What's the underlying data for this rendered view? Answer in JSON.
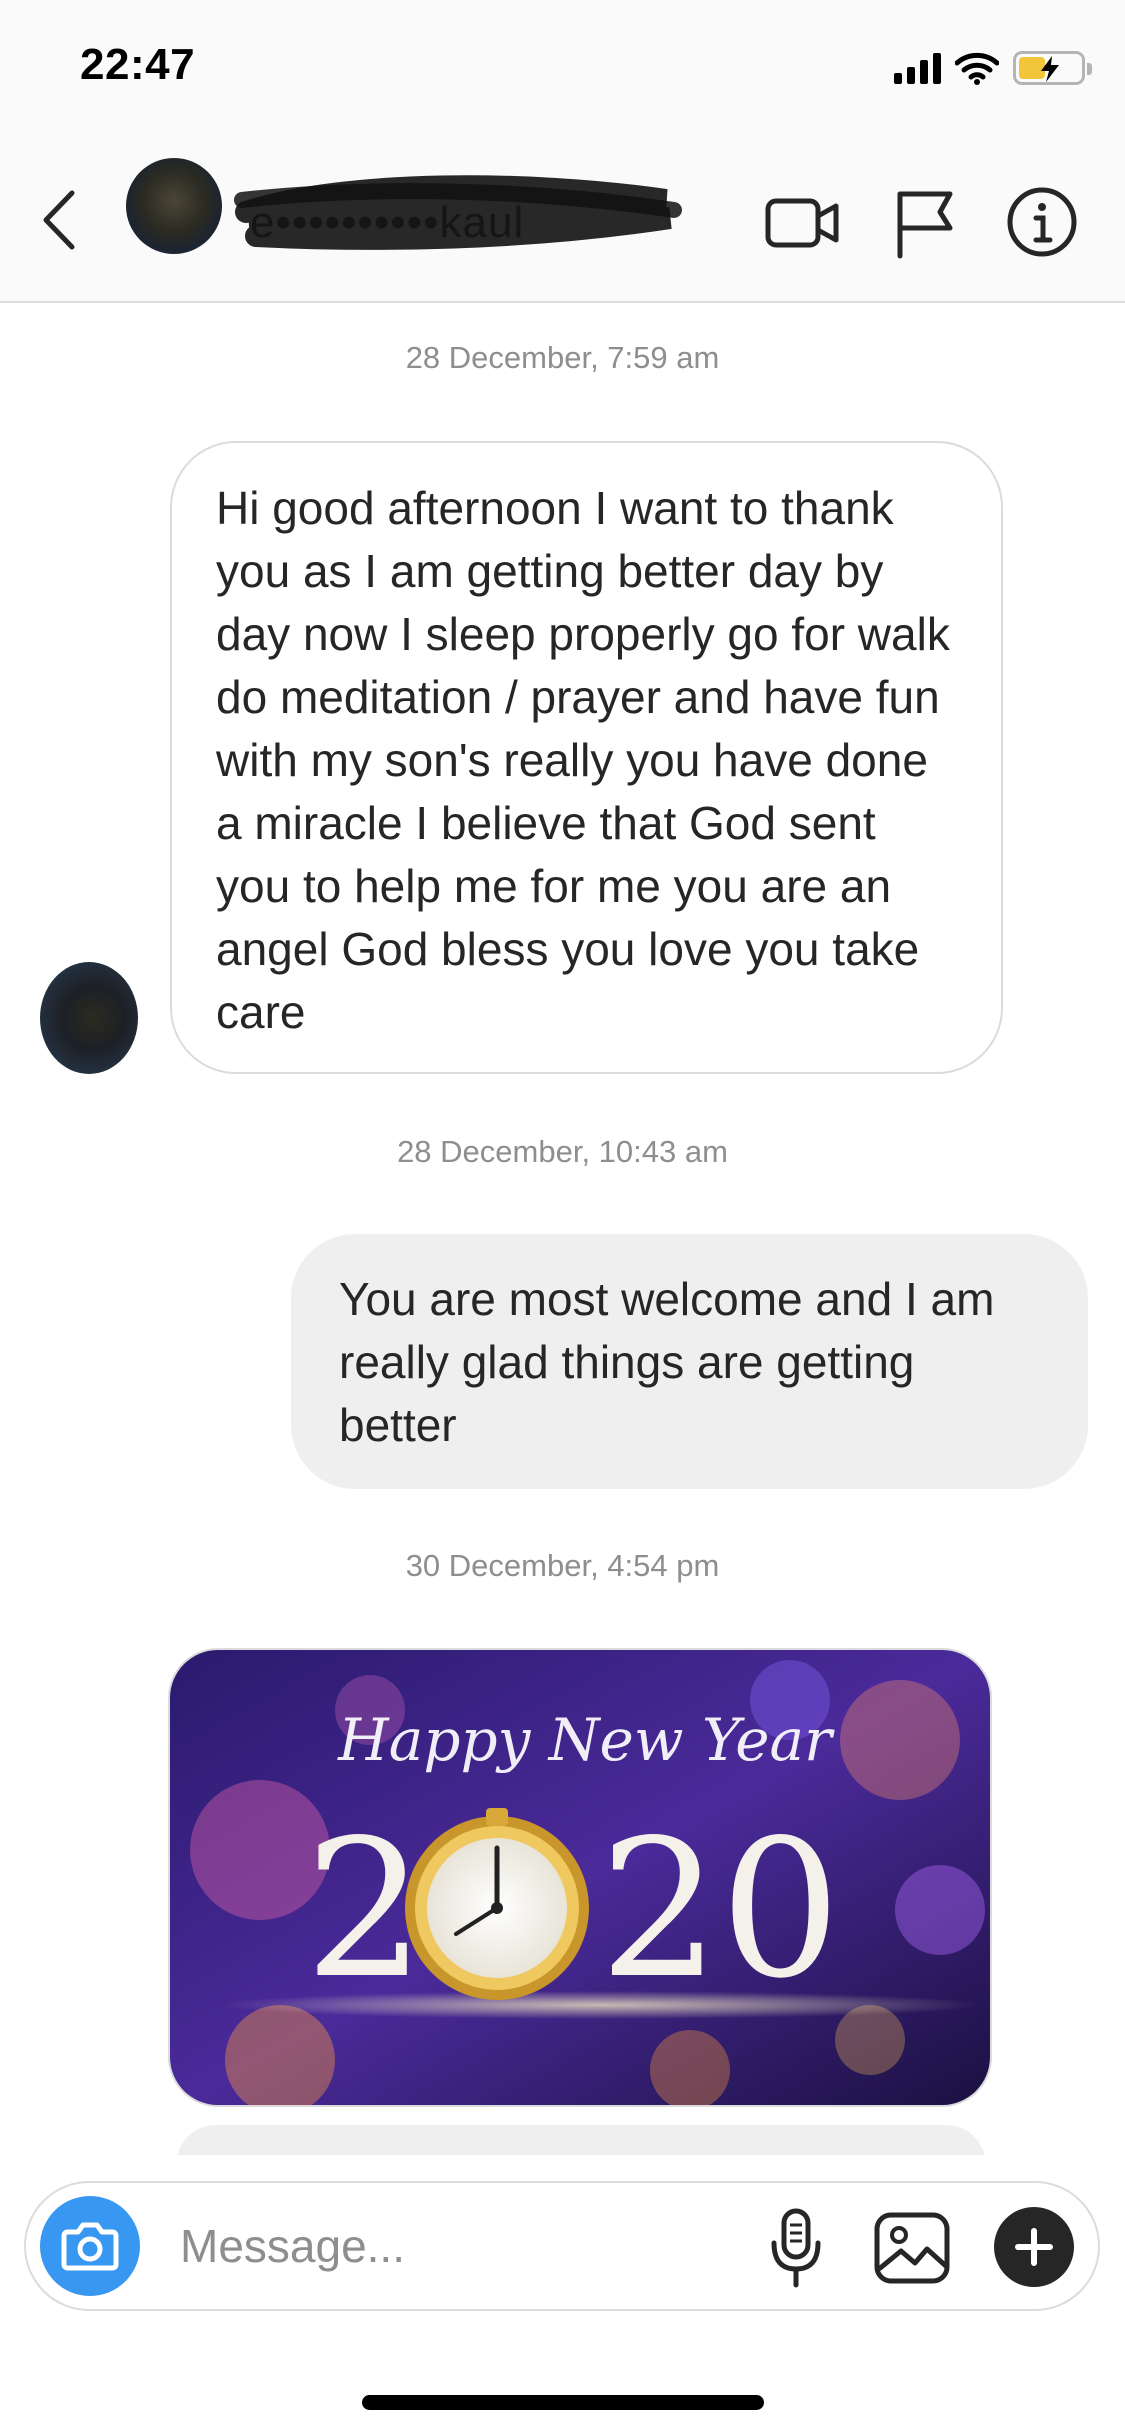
{
  "status_bar": {
    "time": "22:47"
  },
  "header": {
    "contact_name": "e••••••••••kaul",
    "back_icon": "chevron-left-icon",
    "video_icon": "video-camera-icon",
    "flag_icon": "flag-icon",
    "info_icon": "info-icon"
  },
  "messages": [
    {
      "timestamp": "28 December, 7:59 am"
    },
    {
      "text": "Hi good afternoon I want to thank you as I am getting better day by day now I sleep properly go for walk do meditation / prayer  and have fun with my son's really you have done a miracle  I believe that God  sent you to help me for me you are an angel God bless you love you take care"
    },
    {
      "timestamp": "28 December, 10:43 am"
    },
    {
      "text": "You are most welcome and I am really glad things are getting better"
    },
    {
      "timestamp": "30 December, 4:54 pm"
    },
    {
      "image_text_line1": "Happy New Year",
      "image_text_line2_left": "2",
      "image_text_line2_right": "20"
    }
  ],
  "composer": {
    "placeholder": "Message..."
  },
  "colors": {
    "accent": "#3897f0",
    "incoming_border": "#dbdbdb",
    "outgoing_bg": "#efefef",
    "timestamp": "#8e8e8e",
    "battery": "#f2c63a"
  }
}
